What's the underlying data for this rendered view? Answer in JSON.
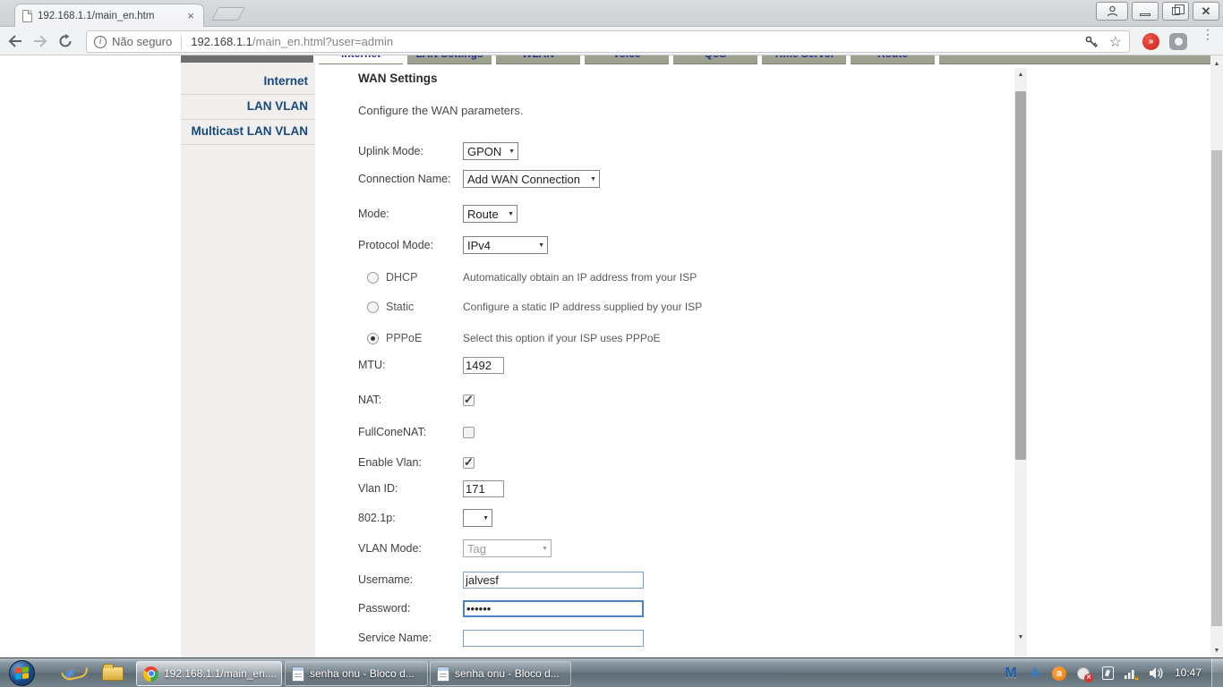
{
  "icons": {
    "close_tab": "×",
    "back": "←",
    "forward": "→",
    "reload": "⟳",
    "info_i": "i",
    "star": "☆",
    "menu": "⋮",
    "dropdown": "▼",
    "scroll_up": "▲",
    "scroll_down": "▼",
    "ext_red_glyph": "»",
    "ie_glyph": "e",
    "mwb_glyph": "M",
    "anydesk_glyph": "A",
    "avast_glyph": "a"
  },
  "browser": {
    "tab_title": "192.168.1.1/main_en.htm",
    "security_label": "Não seguro",
    "url_host": "192.168.1.1",
    "url_path": "/main_en.html?user=admin"
  },
  "router": {
    "top_tabs": [
      {
        "label": "Internet",
        "selected": true
      },
      {
        "label": "LAN Settings",
        "selected": false
      },
      {
        "label": "WLAN",
        "selected": false
      },
      {
        "label": "Voice",
        "selected": false
      },
      {
        "label": "QoS",
        "selected": false
      },
      {
        "label": "Time Server",
        "selected": false
      },
      {
        "label": "Route",
        "selected": false
      }
    ],
    "sidebar": {
      "items": [
        {
          "label": "Internet"
        },
        {
          "label": "LAN VLAN"
        },
        {
          "label": "Multicast LAN VLAN"
        }
      ]
    },
    "page_title": "WAN Settings",
    "page_subtitle": "Configure the WAN parameters.",
    "form": {
      "uplink_mode": {
        "label": "Uplink Mode:",
        "value": "GPON"
      },
      "connection_name": {
        "label": "Connection Name:",
        "value": "Add WAN Connection"
      },
      "mode": {
        "label": "Mode:",
        "value": "Route"
      },
      "protocol_mode": {
        "label": "Protocol Mode:",
        "value": "IPv4"
      },
      "ip_options": [
        {
          "label": "DHCP",
          "desc": "Automatically obtain an IP address from your ISP"
        },
        {
          "label": "Static",
          "desc": "Configure a static IP address supplied by your ISP"
        },
        {
          "label": "PPPoE",
          "desc": "Select this option if your ISP uses PPPoE",
          "checked_attr": "checked"
        }
      ],
      "mtu": {
        "label": "MTU:",
        "value": "1492"
      },
      "nat": {
        "label": "NAT:",
        "checked_attr": "checked"
      },
      "fullconenat": {
        "label": "FullConeNAT:"
      },
      "enable_vlan": {
        "label": "Enable Vlan:",
        "checked_attr": "checked"
      },
      "vlan_id": {
        "label": "Vlan ID:",
        "value": "171"
      },
      "p802_1p": {
        "label": "802.1p:",
        "value": ""
      },
      "vlan_mode": {
        "label": "VLAN Mode:",
        "value": "Tag"
      },
      "username": {
        "label": "Username:",
        "value": "jalvesf"
      },
      "password": {
        "label": "Password:",
        "value": "••••••"
      },
      "service_name": {
        "label": "Service Name:",
        "value": ""
      }
    }
  },
  "taskbar": {
    "tasks": [
      {
        "label": "192.168.1.1/main_en...."
      },
      {
        "label": "senha onu - Bloco d..."
      },
      {
        "label": "senha onu - Bloco d..."
      }
    ],
    "clock": "10:47"
  }
}
